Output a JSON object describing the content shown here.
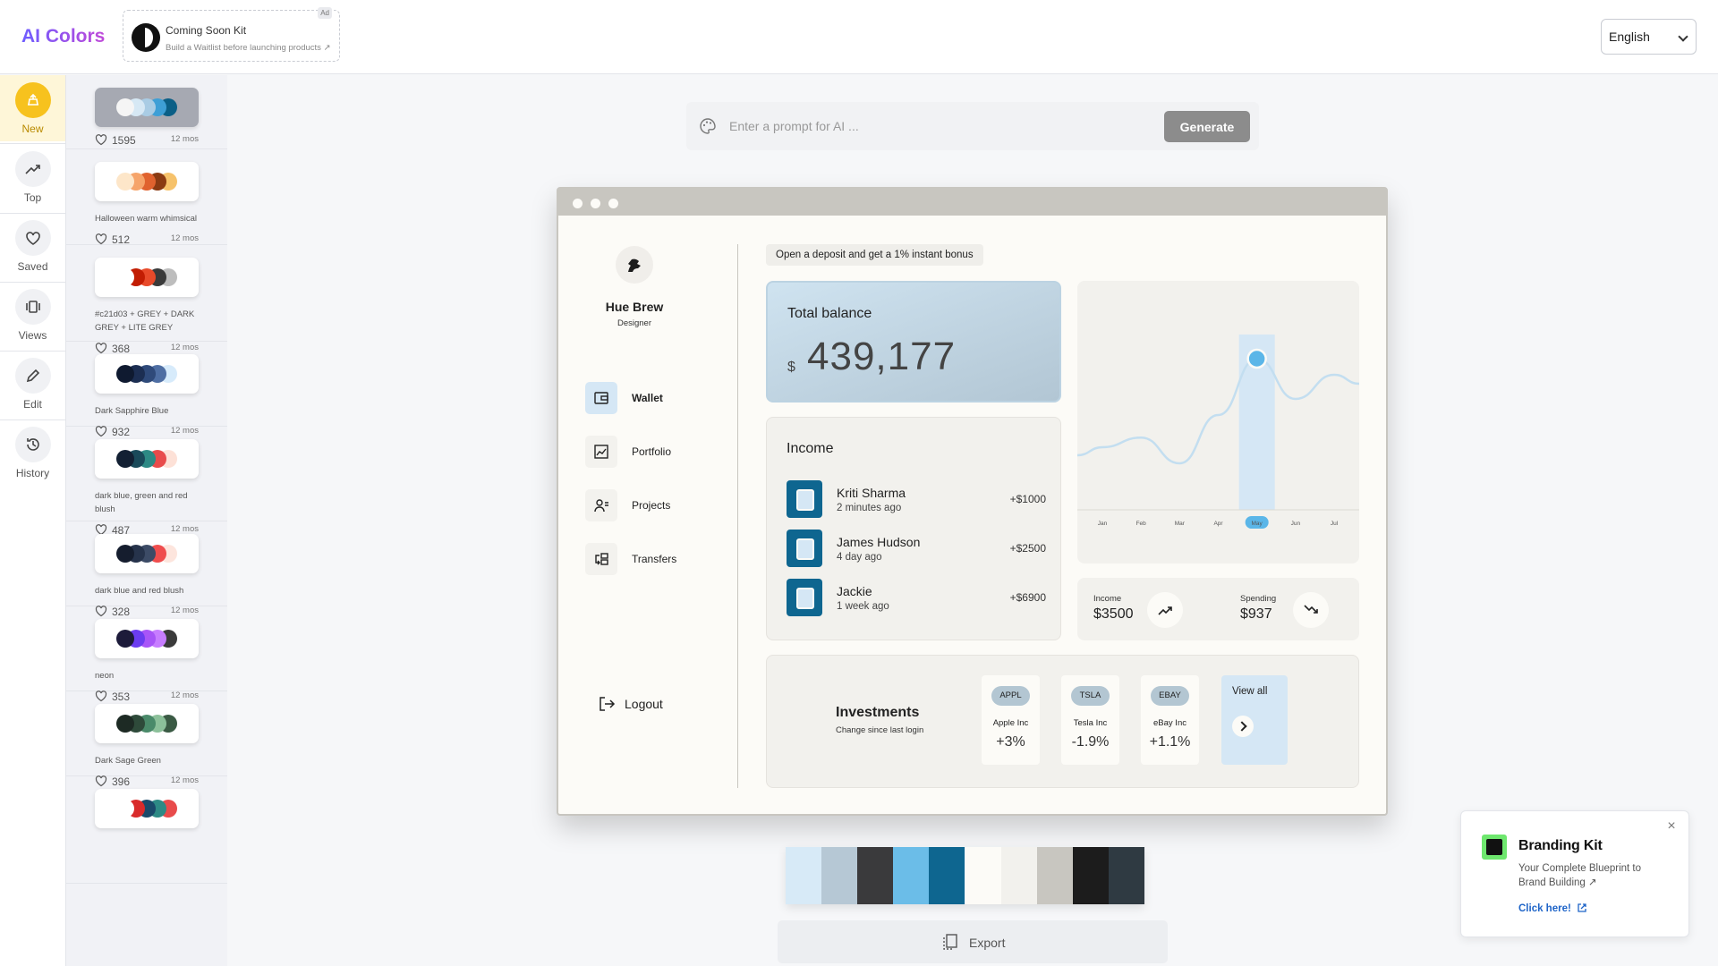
{
  "header": {
    "logo": "AI Colors",
    "ad": {
      "tag": "Ad",
      "title": "Coming Soon Kit",
      "subtitle": "Build a Waitlist before launching products ↗"
    },
    "language": "English"
  },
  "nav": [
    {
      "label": "New",
      "icon": "new-icon",
      "active": true
    },
    {
      "label": "Top",
      "icon": "trending-up-icon"
    },
    {
      "label": "Saved",
      "icon": "heart-icon"
    },
    {
      "label": "Views",
      "icon": "views-icon"
    },
    {
      "label": "Edit",
      "icon": "pencil-icon"
    },
    {
      "label": "History",
      "icon": "history-icon"
    }
  ],
  "palettes": [
    {
      "name": "",
      "likes": "1595",
      "age": "12 mos",
      "colors": [
        "#f5f5f5",
        "#d6e8f4",
        "#a9cce4",
        "#3e9fd6",
        "#0b5f86"
      ],
      "selected": true
    },
    {
      "name": "Halloween warm whimsical",
      "likes": "512",
      "age": "12 mos",
      "colors": [
        "#fde6c9",
        "#f6a46a",
        "#e0622e",
        "#8a3a12",
        "#f6c26b"
      ]
    },
    {
      "name": "#c21d03 + GREY + DARK GREY + LITE GREY",
      "likes": "368",
      "age": "12 mos",
      "colors": [
        "#ffffff",
        "#c21d03",
        "#e84a2a",
        "#3a3a3a",
        "#bdbdbd"
      ]
    },
    {
      "name": "Dark Sapphire Blue",
      "likes": "932",
      "age": "12 mos",
      "colors": [
        "#0f1a30",
        "#1c2e52",
        "#2f4a7a",
        "#4e6ea3",
        "#d7ebfb"
      ]
    },
    {
      "name": "dark blue, green and red blush",
      "likes": "487",
      "age": "12 mos",
      "colors": [
        "#132033",
        "#1a4a5a",
        "#2d8a85",
        "#e84b4b",
        "#fde1d7"
      ]
    },
    {
      "name": "dark blue and red blush",
      "likes": "328",
      "age": "12 mos",
      "colors": [
        "#151d2e",
        "#26334b",
        "#3c4b66",
        "#ef4d4d",
        "#fde5dd"
      ]
    },
    {
      "name": "neon",
      "likes": "353",
      "age": "12 mos",
      "colors": [
        "#1d1b3a",
        "#6b3cf0",
        "#a855f7",
        "#c77dff",
        "#3a3a3a"
      ]
    },
    {
      "name": "Dark Sage Green",
      "likes": "396",
      "age": "12 mos",
      "colors": [
        "#1d2a24",
        "#2e4a3a",
        "#4a8a6a",
        "#8cc09a",
        "#3a5a44"
      ]
    },
    {
      "name": "",
      "likes": "",
      "age": "",
      "colors": [
        "#ffffff",
        "#d92b2b",
        "#1a4a6a",
        "#2d8a85",
        "#e84b4b"
      ]
    }
  ],
  "prompt": {
    "placeholder": "Enter a prompt for AI ...",
    "button": "Generate"
  },
  "preview": {
    "profile": {
      "name": "Hue Brew",
      "role": "Designer"
    },
    "menu": [
      {
        "label": "Wallet",
        "icon": "wallet-icon",
        "active": true
      },
      {
        "label": "Portfolio",
        "icon": "portfolio-icon"
      },
      {
        "label": "Projects",
        "icon": "projects-icon"
      },
      {
        "label": "Transfers",
        "icon": "transfers-icon"
      }
    ],
    "logout": "Logout",
    "promo": "Open a deposit and get a 1% instant bonus",
    "balance": {
      "title": "Total balance",
      "currency": "$",
      "value": "439,177"
    },
    "income": {
      "title": "Income",
      "items": [
        {
          "name": "Kriti Sharma",
          "time": "2 minutes ago",
          "amount": "+$1000"
        },
        {
          "name": "James Hudson",
          "time": "4 day ago",
          "amount": "+$2500"
        },
        {
          "name": "Jackie",
          "time": "1 week ago",
          "amount": "+$6900"
        }
      ]
    },
    "stats": {
      "income_label": "Income",
      "income_value": "$3500",
      "spending_label": "Spending",
      "spending_value": "$937"
    },
    "investments": {
      "title": "Investments",
      "subtitle": "Change since last login",
      "stocks": [
        {
          "tag": "APPL",
          "name": "Apple Inc",
          "change": "+3%"
        },
        {
          "tag": "TSLA",
          "name": "Tesla Inc",
          "change": "-1.9%"
        },
        {
          "tag": "EBAY",
          "name": "eBay Inc",
          "change": "+1.1%"
        }
      ],
      "view_all": "View all"
    },
    "colors": {
      "frame": "#c8c6c0",
      "accent": "#5bb6e8",
      "dark_accent": "#0e6690",
      "card": "#f2f1ed",
      "background": "#fcfbf7"
    }
  },
  "chart_data": {
    "type": "line",
    "categories": [
      "Jan",
      "Feb",
      "Mar",
      "Apr",
      "May",
      "Jun",
      "Jul"
    ],
    "values": [
      0.3,
      0.36,
      0.2,
      0.5,
      0.85,
      0.6,
      0.75
    ],
    "highlight": "May",
    "title": "",
    "xlabel": "",
    "ylabel": "",
    "grid": false
  },
  "palette_strip": [
    "#d7eaf7",
    "#b6c8d5",
    "#3a3a3c",
    "#6bbde8",
    "#0e6690",
    "#fcfbf7",
    "#f2f1ed",
    "#c8c6c0",
    "#1c1c1c",
    "#2f3a42"
  ],
  "export": "Export",
  "branding": {
    "title": "Branding Kit",
    "subtitle": "Your Complete Blueprint to Brand Building ↗",
    "link": "Click here!",
    "close": "×"
  }
}
